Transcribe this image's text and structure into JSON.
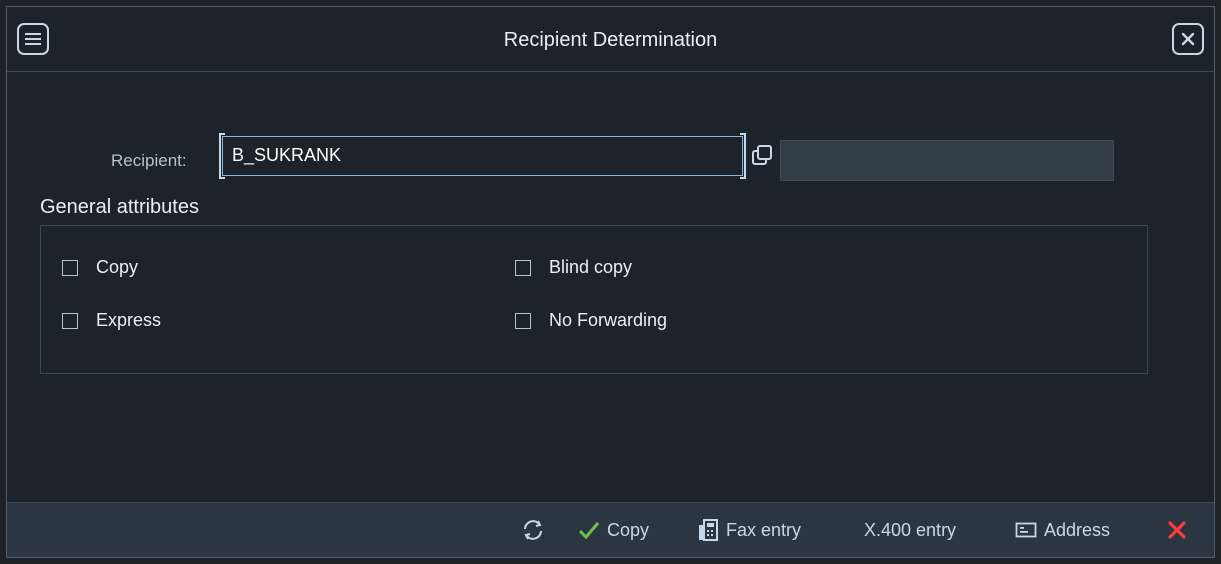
{
  "dialog": {
    "title": "Recipient Determination"
  },
  "recipient": {
    "label": "Recipient:",
    "value": "B_SUKRANK"
  },
  "general_attributes": {
    "title": "General attributes",
    "options": [
      {
        "label": "Copy",
        "checked": false
      },
      {
        "label": "Blind copy",
        "checked": false
      },
      {
        "label": "Express",
        "checked": false
      },
      {
        "label": "No Forwarding",
        "checked": false
      }
    ]
  },
  "footer": {
    "refresh_icon": "refresh-icon",
    "copy_label": "Copy",
    "fax_label": "Fax entry",
    "x400_label": "X.400 entry",
    "address_label": "Address",
    "cancel_icon": "cancel-icon"
  },
  "colors": {
    "accent": "#8fb8de",
    "copy_check": "#6fc04a",
    "cancel_red": "#ff3b3b"
  }
}
